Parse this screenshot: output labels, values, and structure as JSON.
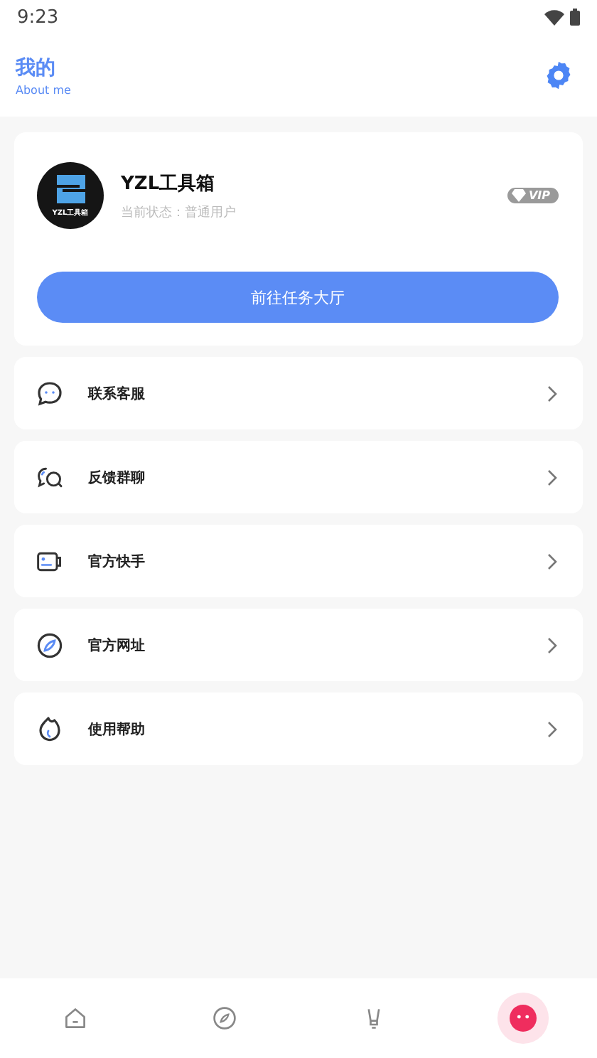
{
  "status_bar": {
    "time": "9:23"
  },
  "header": {
    "title": "我的",
    "subtitle": "About me"
  },
  "profile": {
    "logo_text": "YZL工具箱",
    "name": "YZL工具箱",
    "status": "当前状态：普通用户",
    "badge": "VIP",
    "button": "前往任务大厅"
  },
  "menu": [
    {
      "kind": "chat",
      "label": "联系客服"
    },
    {
      "kind": "group",
      "label": "反馈群聊"
    },
    {
      "kind": "card",
      "label": "官方快手"
    },
    {
      "kind": "compass",
      "label": "官方网址"
    },
    {
      "kind": "flame",
      "label": "使用帮助"
    }
  ],
  "bottom_nav": [
    {
      "kind": "home",
      "selected": false
    },
    {
      "kind": "compass",
      "selected": false
    },
    {
      "kind": "bulb",
      "selected": false
    },
    {
      "kind": "me",
      "selected": true
    }
  ]
}
